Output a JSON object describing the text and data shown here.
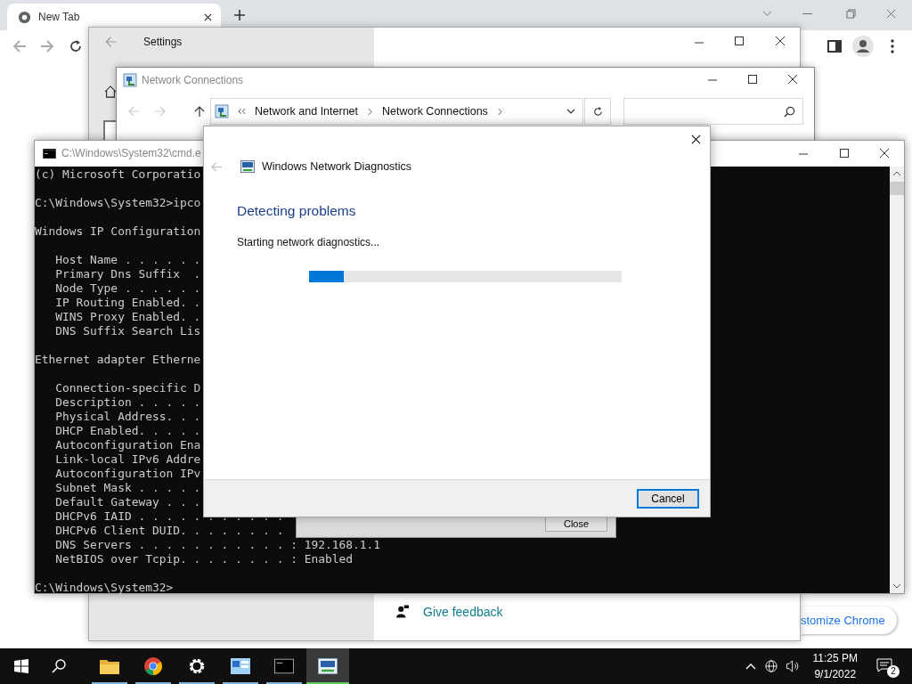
{
  "browser": {
    "tab": {
      "title": "New Tab"
    },
    "customize_button": "stomize Chrome"
  },
  "settings_window": {
    "title": "Settings",
    "feedback_link": "Give feedback"
  },
  "network_connections": {
    "title": "Network Connections",
    "breadcrumbs": [
      "Network and Internet",
      "Network Connections"
    ]
  },
  "cmd_window": {
    "title": "C:\\Windows\\System32\\cmd.e",
    "blocks": [
      [
        "(c) Microsoft Corporatio"
      ],
      [
        "C:\\Windows\\System32>ipco"
      ],
      [
        "Windows IP Configuration"
      ],
      [
        "   Host Name . . . . . .",
        "   Primary Dns Suffix  .",
        "   Node Type . . . . . .",
        "   IP Routing Enabled. .",
        "   WINS Proxy Enabled. .",
        "   DNS Suffix Search Lis"
      ],
      [
        "Ethernet adapter Etherne"
      ],
      [
        "   Connection-specific D",
        "   Description . . . . .",
        "   Physical Address. . .",
        "   DHCP Enabled. . . . .",
        "   Autoconfiguration Ena",
        "   Link-local IPv6 Addre",
        "   Autoconfiguration IPv",
        "   Subnet Mask . . . . .",
        "   Default Gateway . . .",
        "   DHCPv6 IAID . . . . . . . . . . .",
        "   DHCPv6 Client DUID. . . . . . . .",
        "   DNS Servers . . . . . . . . . . . : 192.168.1.1",
        "   NetBIOS over Tcpip. . . . . . . . : Enabled"
      ],
      [
        "C:\\Windows\\System32>"
      ]
    ]
  },
  "message_box": {
    "button": "Close"
  },
  "diagnostics": {
    "title": "Windows Network Diagnostics",
    "heading": "Detecting problems",
    "status": "Starting network diagnostics...",
    "progress": {
      "level": 0.11
    },
    "cancel_button": "Cancel"
  },
  "taskbar": {
    "apps": [
      {
        "kind": "folder",
        "selected": false
      },
      {
        "kind": "chrome",
        "selected": false
      },
      {
        "kind": "gear",
        "selected": false
      },
      {
        "kind": "control-panel",
        "selected": false
      },
      {
        "kind": "terminal",
        "selected": false
      },
      {
        "kind": "diagnostics",
        "selected": true
      }
    ],
    "time": "11:25 PM",
    "date": "9/1/2022",
    "notifications": "2"
  }
}
